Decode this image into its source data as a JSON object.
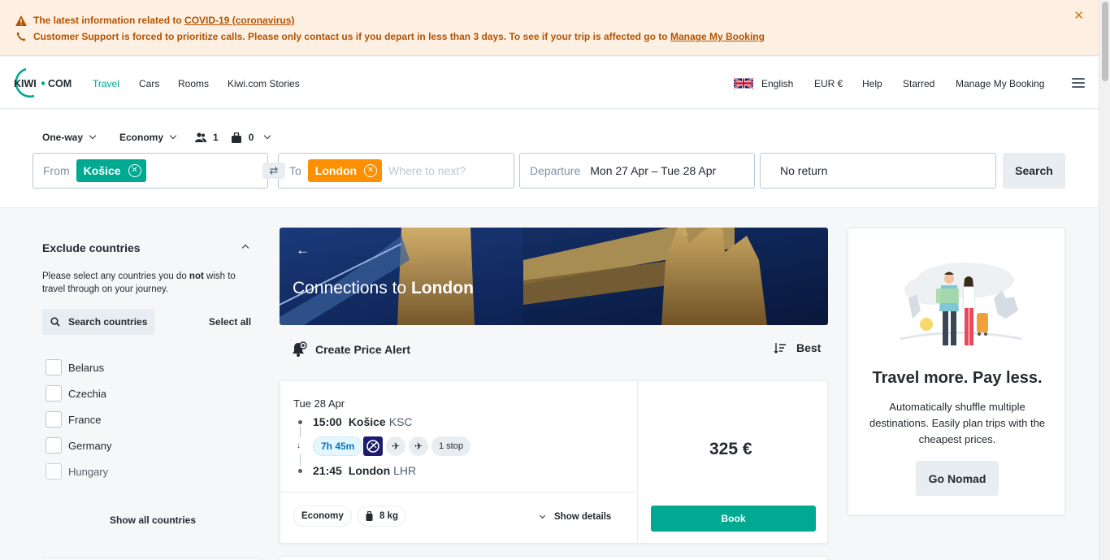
{
  "banner": {
    "line1_prefix": "The latest information related to ",
    "line1_link": "COVID-19 (coronavirus)",
    "line2_prefix": "Customer Support is forced to prioritize calls. Please only contact us if you depart in less than 3 days. To see if your trip is affected go to ",
    "line2_link": "Manage My Booking",
    "close_icon": "close-icon"
  },
  "nav": {
    "logo_left": "KIWI",
    "logo_right": "COM",
    "links": [
      "Travel",
      "Cars",
      "Rooms",
      "Kiwi.com Stories"
    ],
    "language": "English",
    "currency": "EUR €",
    "help": "Help",
    "starred": "Starred",
    "manage": "Manage My Booking"
  },
  "search": {
    "trip_type": "One-way",
    "cabin": "Economy",
    "passengers": "1",
    "bags": "0",
    "from_label": "From",
    "from_value": "Košice",
    "to_label": "To",
    "to_value": "London",
    "to_placeholder": "Where to next?",
    "departure_label": "Departure",
    "departure_value": "Mon 27 Apr – Tue 28 Apr",
    "return_value": "No return",
    "search_button": "Search"
  },
  "sidebar": {
    "title": "Exclude countries",
    "desc_before": "Please select any countries you do ",
    "desc_bold": "not",
    "desc_after": " wish to travel through on your journey.",
    "search_label": "Search countries",
    "select_all": "Select all",
    "countries": [
      "Belarus",
      "Czechia",
      "France",
      "Germany",
      "Hungary"
    ],
    "show_all": "Show all countries"
  },
  "hero": {
    "prefix": "Connections to ",
    "city": "London"
  },
  "results": {
    "price_alert": "Create Price Alert",
    "sort": "Best",
    "card": {
      "date": "Tue 28 Apr",
      "dep_time": "15:00",
      "dep_city": "Košice",
      "dep_code": "KSC",
      "duration": "7h 45m",
      "stops": "1 stop",
      "arr_time": "21:45",
      "arr_city": "London",
      "arr_code": "LHR",
      "cabin": "Economy",
      "bag": "8 kg",
      "show_details": "Show details",
      "price": "325 €",
      "book": "Book"
    }
  },
  "nomad": {
    "title": "Travel more. Pay less.",
    "desc": "Automatically shuffle multiple destinations. Easily plan trips with the cheapest prices.",
    "button": "Go Nomad"
  },
  "colors": {
    "accent": "#00a991",
    "orange": "#fc9000",
    "banner_bg": "#fdf0e3",
    "banner_text": "#b45200"
  }
}
